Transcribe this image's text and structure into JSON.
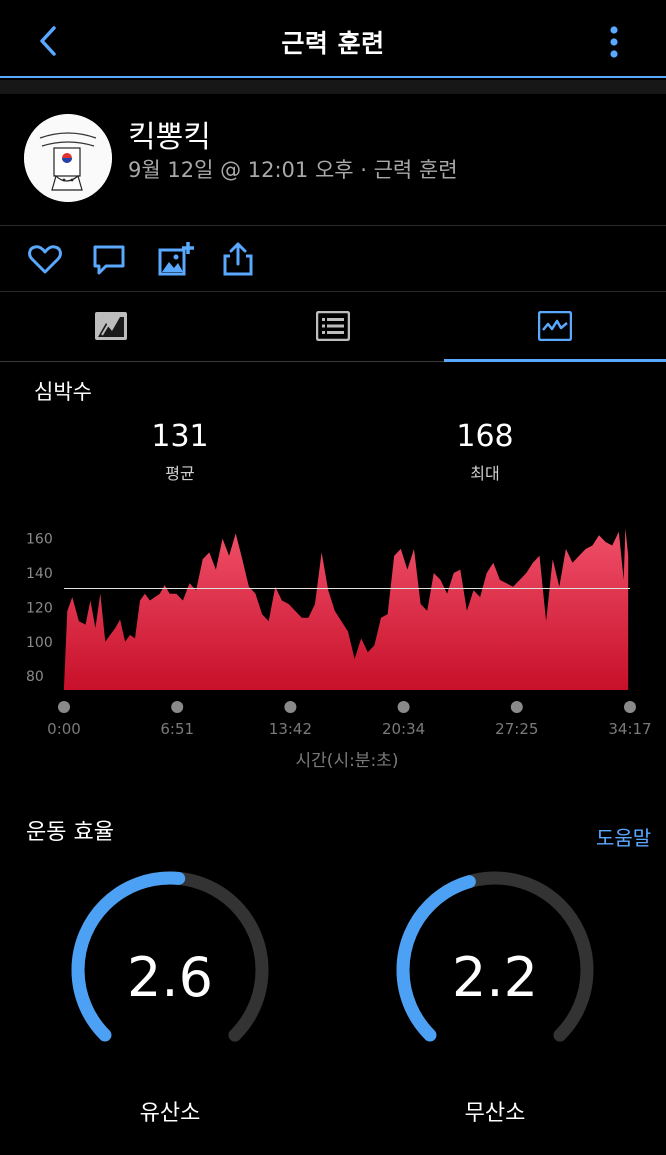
{
  "header": {
    "title": "근력 훈련",
    "back_icon": "chevron-left-icon",
    "more_icon": "vertical-dots-icon",
    "accent": "#5aa9ff"
  },
  "profile": {
    "name": "킥뽕킥",
    "meta": "9월 12일 @ 12:01 오후 · 근력 훈련"
  },
  "actions": [
    "heart-icon",
    "comment-icon",
    "add-photo-icon",
    "share-icon"
  ],
  "tabs": [
    {
      "icon": "summary-icon",
      "active": false
    },
    {
      "icon": "list-icon",
      "active": false
    },
    {
      "icon": "chart-icon",
      "active": true
    }
  ],
  "heart_rate": {
    "label": "심박수",
    "avg_value": "131",
    "avg_label": "평균",
    "max_value": "168",
    "max_label": "최대"
  },
  "chart_data": {
    "type": "area",
    "title": "심박수",
    "xlabel": "시간(시:분:초)",
    "ylabel": "",
    "ylim": [
      72,
      165
    ],
    "xlim_minutes": [
      0,
      34.28
    ],
    "y_ticks": [
      "160",
      "140",
      "120",
      "100",
      "80"
    ],
    "x_ticks": [
      "0:00",
      "6:51",
      "13:42",
      "20:34",
      "27:25",
      "34:17"
    ],
    "average_line": 131,
    "color": "#e83550",
    "series": [
      {
        "x_minutes": [
          0,
          0.2,
          0.5,
          0.9,
          1.3,
          1.6,
          1.9,
          2.2,
          2.5,
          2.8,
          3.1,
          3.4,
          3.7,
          4.0,
          4.3,
          4.6,
          4.9,
          5.2,
          5.5,
          5.8,
          6.1,
          6.4,
          6.8,
          7.2,
          7.6,
          8.0,
          8.4,
          8.8,
          9.2,
          9.6,
          10.0,
          10.4,
          10.8,
          11.2,
          11.6,
          12.0,
          12.4,
          12.8,
          13.2,
          13.6,
          14.0,
          14.4,
          14.8,
          15.2,
          15.6,
          16.0,
          16.4,
          16.8,
          17.2,
          17.6,
          18.0,
          18.4,
          18.8,
          19.2,
          19.6,
          20.0,
          20.4,
          20.8,
          21.2,
          21.6,
          22.0,
          22.4,
          22.8,
          23.2,
          23.6,
          24.0,
          24.4,
          24.8,
          25.2,
          25.6,
          26.0,
          26.4,
          26.8,
          27.2,
          27.6,
          28.0,
          28.4,
          28.8,
          29.2,
          29.6,
          30.0,
          30.4,
          30.8,
          31.2,
          31.6,
          32.0,
          32.4,
          32.8,
          33.2,
          33.6,
          33.9,
          34.0,
          34.17
        ],
        "y": [
          74,
          118,
          126,
          112,
          110,
          124,
          108,
          128,
          100,
          104,
          108,
          113,
          100,
          104,
          102,
          124,
          128,
          124,
          126,
          128,
          133,
          128,
          128,
          124,
          134,
          130,
          148,
          152,
          142,
          160,
          150,
          163,
          148,
          132,
          128,
          116,
          112,
          132,
          124,
          122,
          118,
          114,
          114,
          122,
          152,
          130,
          118,
          112,
          106,
          90,
          102,
          94,
          98,
          114,
          116,
          150,
          154,
          142,
          154,
          122,
          118,
          140,
          136,
          128,
          140,
          142,
          118,
          130,
          126,
          140,
          146,
          136,
          134,
          132,
          136,
          140,
          146,
          150,
          112,
          148,
          132,
          154,
          146,
          150,
          154,
          156,
          162,
          158,
          156,
          164,
          136,
          166,
          150
        ]
      }
    ]
  },
  "efficiency": {
    "title": "운동 효율",
    "help_label": "도움말",
    "aerobic_value": "2.6",
    "aerobic_label": "유산소",
    "aerobic_fraction": 0.52,
    "anaerobic_value": "2.2",
    "anaerobic_label": "무산소",
    "anaerobic_fraction": 0.44,
    "gauge_color": "#4da1f5",
    "track_color": "#333333"
  }
}
